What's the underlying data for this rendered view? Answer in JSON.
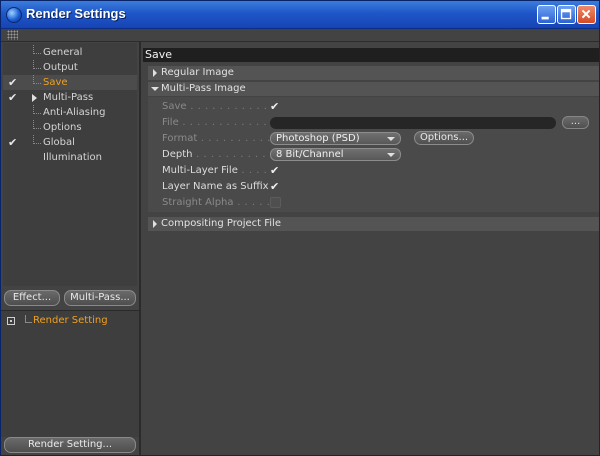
{
  "window": {
    "title": "Render Settings",
    "controls": {
      "minimize": "minimize-icon",
      "maximize": "maximize-icon",
      "close": "close-icon"
    }
  },
  "tree": {
    "items": [
      {
        "label": "General",
        "checked": false
      },
      {
        "label": "Output",
        "checked": false
      },
      {
        "label": "Save",
        "checked": true,
        "selected": true,
        "check_mark": "✔"
      },
      {
        "label": "Multi-Pass",
        "checked": true,
        "expandable": true,
        "check_mark": "✔"
      },
      {
        "label": "Anti-Aliasing",
        "checked": false
      },
      {
        "label": "Options",
        "checked": false
      },
      {
        "label": "Global Illumination",
        "checked": true,
        "check_mark": "✔"
      }
    ]
  },
  "left_buttons": {
    "effect": "Effect...",
    "multipass": "Multi-Pass..."
  },
  "render_settings_list": {
    "item": "Render Setting"
  },
  "bottom_button": "Render Setting...",
  "panel": {
    "header": "Save",
    "regular_image": "Regular Image",
    "multipass_image": "Multi-Pass Image",
    "rows": {
      "save": {
        "label": "Save",
        "dots": " . . . . . . . . . . . . . .",
        "checked": true
      },
      "file": {
        "label": "File",
        "dots": " . . . . . . . . . . . . . . . .",
        "value": "",
        "browse": "..."
      },
      "format": {
        "label": "Format",
        "dots": " . . . . . . . . . . . .",
        "value": "Photoshop (PSD)",
        "options": "Options..."
      },
      "depth": {
        "label": "Depth",
        "dots": " . . . . . . . . . . . . . .",
        "value": "8 Bit/Channel"
      },
      "multilayer": {
        "label": "Multi-Layer File",
        "dots": " . . . . . . . .",
        "checked": true
      },
      "layername": {
        "label": "Layer Name as Suffix",
        "dots": " . . .",
        "checked": true
      },
      "straight": {
        "label": "Straight Alpha",
        "dots": " . . . . . . . . .",
        "checked": false
      }
    },
    "compositing": "Compositing Project File"
  },
  "colors": {
    "accent_orange": "#f0a020",
    "panel_bg": "#434343",
    "titlebar": "#1e56c8"
  },
  "check_glyph": "✔"
}
